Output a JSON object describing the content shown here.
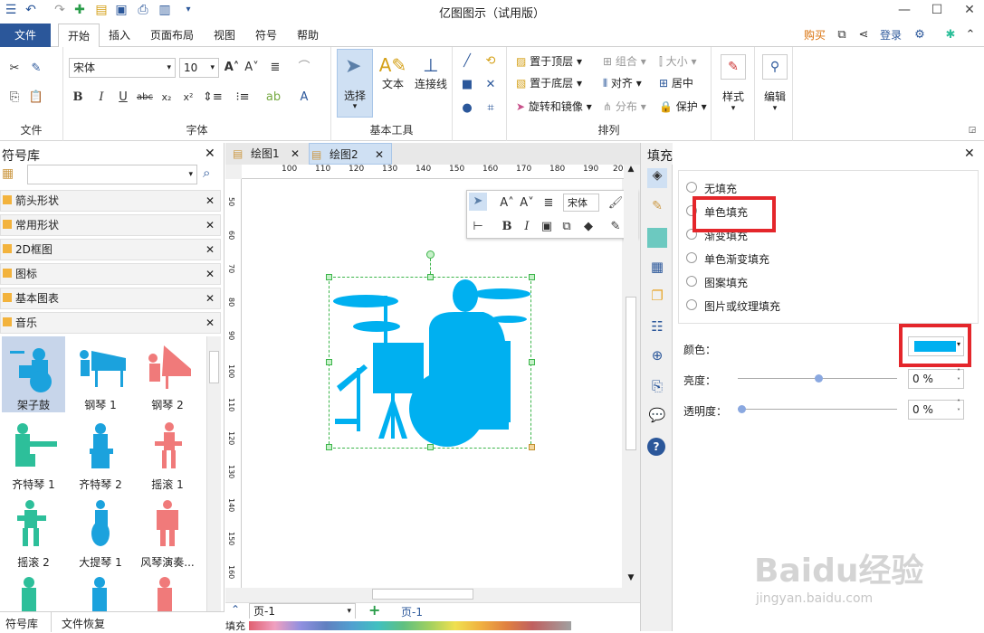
{
  "window": {
    "title": "亿图图示（试用版）"
  },
  "menubar": {
    "file": "文件",
    "tabs": [
      "开始",
      "插入",
      "页面布局",
      "视图",
      "符号",
      "帮助"
    ],
    "buy": "购买",
    "login": "登录"
  },
  "ribbon": {
    "groups": {
      "file": "文件",
      "font": "字体",
      "basic_tools": "基本工具",
      "arrange": "排列"
    },
    "font_name": "宋体",
    "font_size": "10",
    "tools": {
      "select": "选择",
      "text": "文本",
      "connector": "连接线"
    },
    "arrange": {
      "bring_front": "置于顶层",
      "send_back": "置于底层",
      "rotate": "旋转和镜像",
      "group": "组合",
      "align": "对齐",
      "distribute": "分布",
      "size": "大小",
      "center": "居中",
      "protect": "保护"
    },
    "style": "样式",
    "edit": "编辑"
  },
  "library": {
    "title": "符号库",
    "categories": [
      "箭头形状",
      "常用形状",
      "2D框图",
      "图标",
      "基本图表",
      "音乐"
    ],
    "shapes": [
      {
        "label": "架子鼓",
        "color": "#1ba2dd"
      },
      {
        "label": "钢琴 1",
        "color": "#1ba2dd"
      },
      {
        "label": "钢琴 2",
        "color": "#f07a7a"
      },
      {
        "label": "齐特琴 1",
        "color": "#2dbf9a"
      },
      {
        "label": "齐特琴 2",
        "color": "#1ba2dd"
      },
      {
        "label": "摇滚 1",
        "color": "#f07a7a"
      },
      {
        "label": "摇滚 2",
        "color": "#2dbf9a"
      },
      {
        "label": "大提琴 1",
        "color": "#1ba2dd"
      },
      {
        "label": "风琴演奏...",
        "color": "#f07a7a"
      }
    ],
    "footer_tabs": [
      "符号库",
      "文件恢复"
    ]
  },
  "doc_tabs": [
    "绘图1",
    "绘图2"
  ],
  "ruler": {
    "h": [
      "100",
      "110",
      "120",
      "130",
      "140",
      "150",
      "160",
      "170",
      "180",
      "190",
      "200"
    ],
    "v": [
      "50",
      "60",
      "70",
      "80",
      "90",
      "100",
      "110",
      "120",
      "130",
      "140",
      "150",
      "160"
    ]
  },
  "float_toolbar": {
    "font": "宋体"
  },
  "page_bar": {
    "page_select": "页-1",
    "page_tab": "页-1",
    "fill_label": "填充"
  },
  "fill_panel": {
    "title": "填充",
    "options": [
      "无填充",
      "单色填充",
      "渐变填充",
      "单色渐变填充",
      "图案填充",
      "图片或纹理填充"
    ],
    "color_label": "颜色：",
    "color_value": "#00b0f0",
    "brightness_label": "亮度：",
    "brightness_value": "0 %",
    "transparency_label": "透明度：",
    "transparency_value": "0 %"
  },
  "watermark": {
    "brand": "Baidu经验",
    "url": "jingyan.baidu.com"
  },
  "colors": {
    "accent": "#2b579a",
    "shape_blue": "#00b0f0",
    "highlight": "#e4262b"
  }
}
